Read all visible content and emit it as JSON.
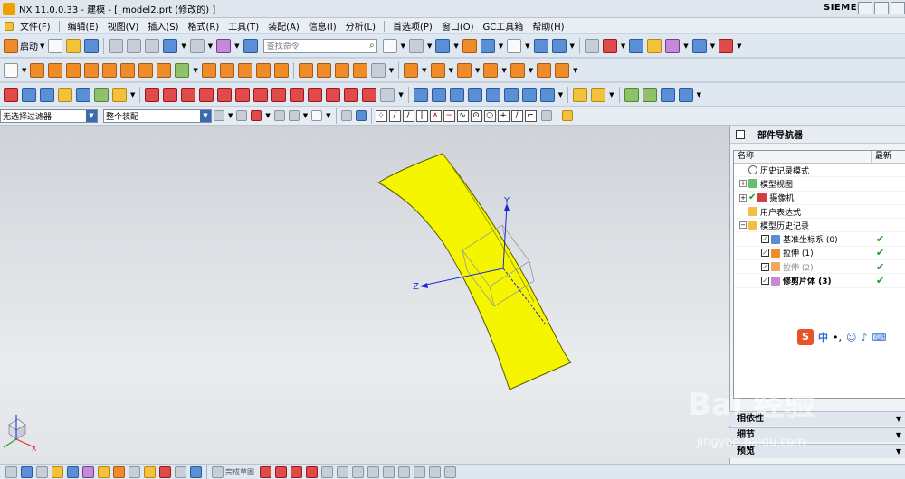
{
  "window": {
    "title": "NX 11.0.0.33 - 建模 - [_model2.prt  (修改的) ]",
    "brand": "SIEMENS"
  },
  "menu": [
    "文件(F)",
    "编辑(E)",
    "视图(V)",
    "插入(S)",
    "格式(R)",
    "工具(T)",
    "装配(A)",
    "信息(I)",
    "分析(L)",
    "首选项(P)",
    "窗口(O)",
    "GC工具箱",
    "帮助(H)"
  ],
  "toolbar": {
    "start_label": "启动",
    "search_placeholder": "查找命令"
  },
  "selection_bar": {
    "filter_value": "无选择过滤器",
    "scope_value": "整个装配"
  },
  "viewport": {
    "axis_labels": {
      "x": "X",
      "y": "Y",
      "z": "Z"
    },
    "body_color": "#f5f500"
  },
  "navigator": {
    "title": "部件导航器",
    "columns": [
      "名称",
      "最新"
    ],
    "rows": [
      {
        "label": "历史记录模式",
        "latest": ""
      },
      {
        "label": "模型视图",
        "latest": ""
      },
      {
        "label": "摄像机",
        "latest": ""
      },
      {
        "label": "用户表达式",
        "latest": ""
      },
      {
        "label": "模型历史记录",
        "latest": ""
      },
      {
        "label": "基准坐标系 (0)",
        "latest": "✔"
      },
      {
        "label": "拉伸 (1)",
        "latest": "✔"
      },
      {
        "label": "拉伸 (2)",
        "latest": "✔"
      },
      {
        "label": "修剪片体 (3)",
        "latest": "✔"
      }
    ],
    "ime": {
      "logo": "S",
      "lang": "中"
    },
    "sections": [
      "相依性",
      "细节",
      "预览"
    ]
  },
  "bottom_bar": {
    "finish_sketch": "完成草图"
  },
  "watermark": {
    "brand": "Bai 经验",
    "url": "jingyan.baidu.com"
  }
}
